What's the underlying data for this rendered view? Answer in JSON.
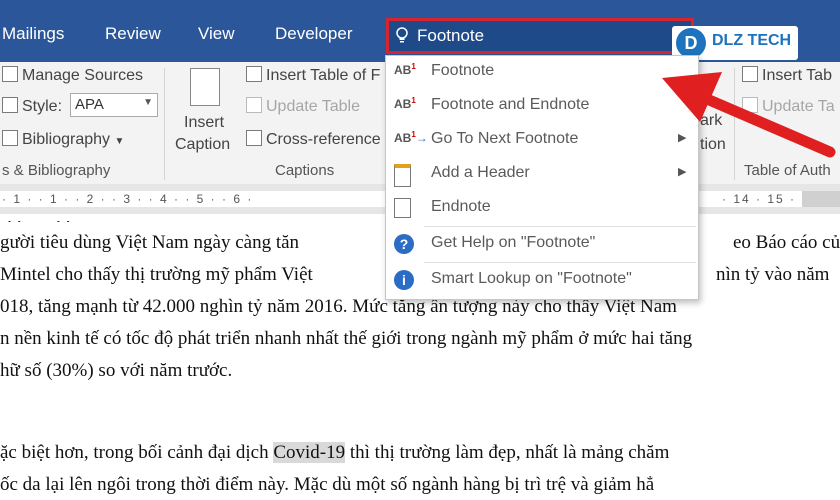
{
  "tabs": [
    "Mailings",
    "Review",
    "View",
    "Developer"
  ],
  "tell_me": {
    "text": "Footnote",
    "icon": "lightbulb-icon"
  },
  "logo": {
    "text": "DLZ TECH",
    "mark": "D"
  },
  "ribbon": {
    "manage_sources": "Manage Sources",
    "style_label": "Style:",
    "style_value": "APA",
    "bibliography": "Bibliography",
    "citations_group": "s & Bibliography",
    "insert_caption_1": "Insert",
    "insert_caption_2": "Caption",
    "insert_table_of_figures": "Insert Table of F",
    "update_table": "Update Table",
    "cross_reference": "Cross-reference",
    "captions_group": "Captions",
    "mark_1": "ark",
    "mark_2": "tion",
    "insert_tab": "Insert Tab",
    "update_ta": "Update Ta",
    "table_of_auth_group": "Table of Auth"
  },
  "ruler": {
    "left": "· 1 · · 1 · · 2 · · 3 · · 4 · · 5 · · 6 ·",
    "right": "· 14 · 15 ·"
  },
  "document": {
    "lines": [
      "gười tiêu dùng Việt Nam ngày càng tăn",
      "Mintel cho thấy thị trường mỹ phẩm Việt",
      "018, tăng mạnh từ 42.000 nghìn tỷ năm 2016. Mức tăng ấn tượng này cho thấy Việt Nam",
      "n nền kinh tế có tốc độ phát triển nhanh nhất thế giới trong ngành mỹ phẩm ở mức hai tăng",
      "hữ số (30%) so với năm trước.",
      "",
      "ặc biệt hơn, trong bối cảnh đại dịch",
      "ốc da lại lên ngôi trong thời điểm này. Mặc dù một số ngành hàng bị trì trệ và giảm hẳ"
    ],
    "line1_right": "eo Báo cáo củ",
    "line2_right": "nìn tỷ vào năm",
    "highlight": "Covid-19",
    "line7_rest": "thì thị trường làm đẹp, nhất là mảng chăm"
  },
  "menu": {
    "items": [
      {
        "label": "Footnote",
        "icon": "ab-superscript-icon",
        "submenu": false
      },
      {
        "label": "Footnote and Endnote",
        "icon": "ab-superscript-icon",
        "submenu": false
      },
      {
        "label": "Go To Next Footnote",
        "icon": "next-footnote-icon",
        "submenu": true
      },
      {
        "label": "Add a Header",
        "icon": "header-page-icon",
        "submenu": true
      },
      {
        "label": "Endnote",
        "icon": "endnote-icon",
        "submenu": false
      },
      {
        "label": "Get Help on \"Footnote\"",
        "icon": "help-icon",
        "submenu": false
      },
      {
        "label": "Smart Lookup on \"Footnote\"",
        "icon": "smart-lookup-icon",
        "submenu": false
      }
    ]
  },
  "colors": {
    "ribbon_tabs": "#2b579a",
    "highlight_box": "#d7252f",
    "arrow": "#e02020"
  }
}
